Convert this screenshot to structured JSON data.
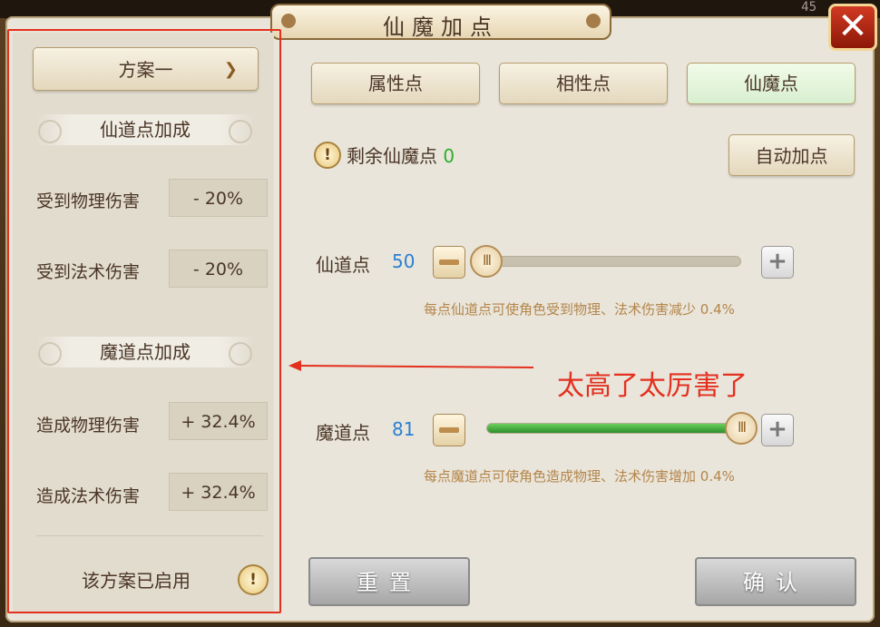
{
  "window": {
    "title": "仙魔加点",
    "corner_number": "45"
  },
  "left": {
    "scheme_select": "方案一",
    "xian_header": "仙道点加成",
    "xian_rows": [
      {
        "label": "受到物理伤害",
        "value": "- 20%"
      },
      {
        "label": "受到法术伤害",
        "value": "- 20%"
      }
    ],
    "mo_header": "魔道点加成",
    "mo_rows": [
      {
        "label": "造成物理伤害",
        "value": "+ 32.4%"
      },
      {
        "label": "造成法术伤害",
        "value": "+ 32.4%"
      }
    ],
    "status": "该方案已启用"
  },
  "tabs": [
    {
      "label": "属性点",
      "active": false
    },
    {
      "label": "相性点",
      "active": false
    },
    {
      "label": "仙魔点",
      "active": true
    }
  ],
  "remaining": {
    "label": "剩余仙魔点",
    "value": "0"
  },
  "auto_button": "自动加点",
  "xian": {
    "label": "仙道点",
    "value": "50",
    "fraction": 0.0,
    "desc": "每点仙道点可使角色受到物理、法术伤害减少 0.4%"
  },
  "mo": {
    "label": "魔道点",
    "value": "81",
    "fraction": 1.0,
    "desc": "每点魔道点可使角色造成物理、法术伤害增加 0.4%"
  },
  "annotation": "太高了太厉害了",
  "buttons": {
    "reset": "重置",
    "confirm": "确认"
  },
  "colors": {
    "annotation_red": "#e4301f",
    "value_blue": "#2b7fd4",
    "remaining_green": "#2eae2e"
  }
}
